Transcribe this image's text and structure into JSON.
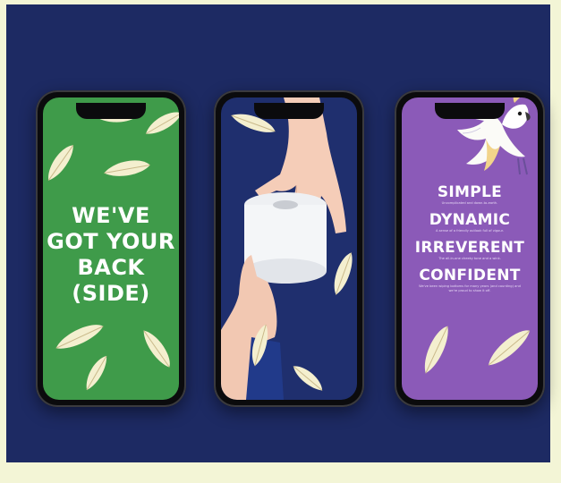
{
  "phones": [
    {
      "id": "phone-1",
      "background": "#3f9b4a",
      "headline": [
        "WE'VE",
        "GOT YOUR",
        "BACK",
        "(SIDE)"
      ]
    },
    {
      "id": "phone-2",
      "background": "#1f2f6e",
      "image": "hands-passing-toilet-roll"
    },
    {
      "id": "phone-3",
      "background": "#8b5ab8",
      "image": "cockatoo-illustration",
      "values": [
        {
          "word": "SIMPLE",
          "desc": "Uncomplicated and down-to-earth."
        },
        {
          "word": "DYNAMIC",
          "desc": "A sense of a friendly outlook full of vigour."
        },
        {
          "word": "IRREVERENT",
          "desc": "The all-in-one cheeky tone and a wink."
        },
        {
          "word": "CONFIDENT",
          "desc": "We've been wiping bottoms for many years (and counting) and we're proud to show it off."
        }
      ]
    }
  ],
  "colors": {
    "stage": "#1d2a63",
    "frame": "#f3f5d6",
    "feather": "#f4efcf",
    "feather_shaft": "#c9b98a",
    "text": "#ffffff"
  }
}
